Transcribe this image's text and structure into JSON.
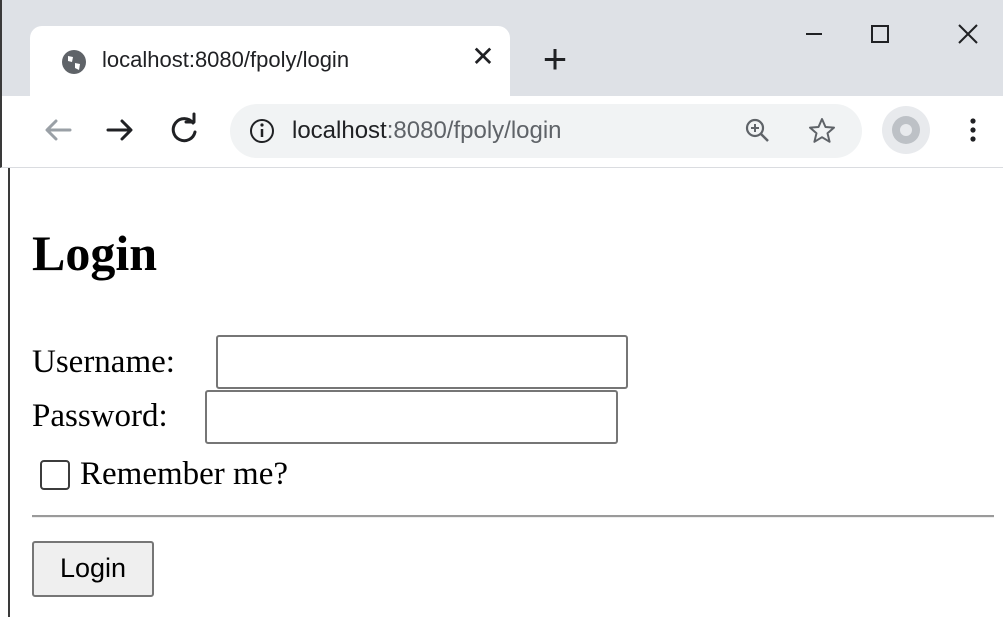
{
  "browser": {
    "tab": {
      "title": "localhost:8080/fpoly/login"
    },
    "address": {
      "host": "localhost",
      "rest": ":8080/fpoly/login"
    }
  },
  "page": {
    "heading": "Login",
    "username": {
      "label": "Username:",
      "value": ""
    },
    "password": {
      "label": "Password:",
      "value": ""
    },
    "remember": {
      "label": "Remember me?",
      "checked": false
    },
    "submit_label": "Login"
  },
  "colors": {
    "tabstrip": "#dee1e6",
    "omnibox": "#f1f3f4",
    "input_border": "#767676",
    "button_bg": "#efefef"
  }
}
